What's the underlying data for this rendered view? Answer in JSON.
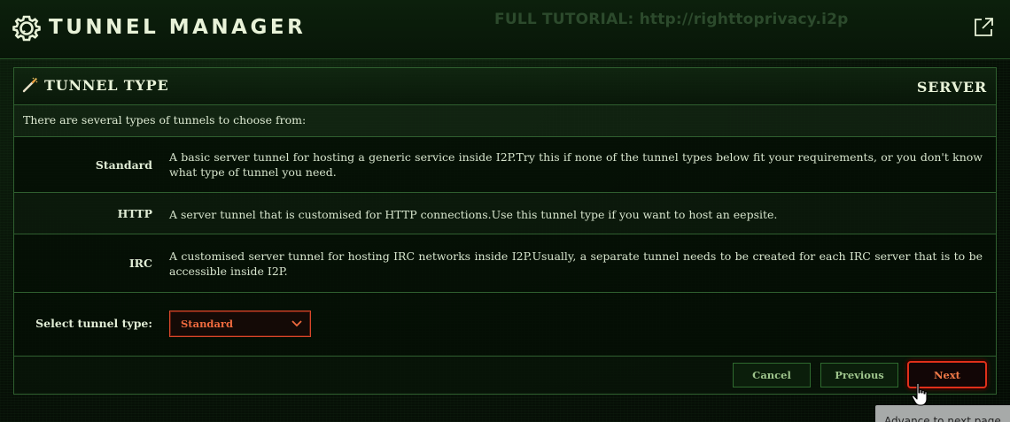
{
  "header": {
    "title": "TUNNEL MANAGER",
    "tutorial_text": "FULL TUTORIAL: http://righttoprivacy.i2p"
  },
  "panel": {
    "title": "TUNNEL TYPE",
    "mode": "SERVER",
    "intro": "There are several types of tunnels to choose from:",
    "types": [
      {
        "label": "Standard",
        "description": "A basic server tunnel for hosting a generic service inside I2P.Try this if none of the tunnel types below fit your requirements, or you don't know what type of tunnel you need."
      },
      {
        "label": "HTTP",
        "description": "A server tunnel that is customised for HTTP connections.Use this tunnel type if you want to host an eepsite."
      },
      {
        "label": "IRC",
        "description": "A customised server tunnel for hosting IRC networks inside I2P.Usually, a separate tunnel needs to be created for each IRC server that is to be accessible inside I2P."
      }
    ],
    "select_label": "Select tunnel type:",
    "select_value": "Standard"
  },
  "buttons": {
    "cancel": "Cancel",
    "previous": "Previous",
    "next": "Next"
  },
  "tooltip": "Advance to next page",
  "icons": {
    "logo": "gear-chat-icon",
    "external": "external-link-icon",
    "title": "wand-icon",
    "select": "chevron-down-icon",
    "pointer": "hand-pointer-icon"
  },
  "colors": {
    "accent": "#e0301a",
    "select_text": "#ee6a3e",
    "border": "#2f5f2f"
  }
}
